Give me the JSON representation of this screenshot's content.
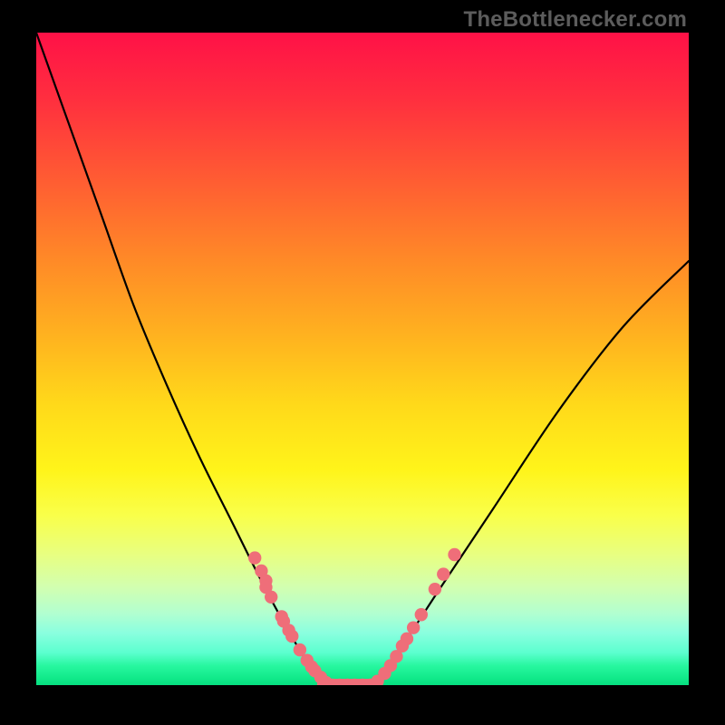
{
  "watermark": "TheBottlenecker.com",
  "chart_data": {
    "type": "line",
    "title": "",
    "xlabel": "",
    "ylabel": "",
    "xlim": [
      0,
      1
    ],
    "ylim": [
      0,
      1
    ],
    "grid": false,
    "series": [
      {
        "name": "curve",
        "color": "#000000",
        "x": [
          0.0,
          0.05,
          0.1,
          0.15,
          0.2,
          0.25,
          0.3,
          0.35,
          0.4,
          0.44,
          0.48,
          0.51,
          0.56,
          0.62,
          0.7,
          0.8,
          0.9,
          1.0
        ],
        "y": [
          1.0,
          0.86,
          0.72,
          0.58,
          0.46,
          0.35,
          0.25,
          0.15,
          0.06,
          0.0,
          0.0,
          0.0,
          0.06,
          0.15,
          0.27,
          0.42,
          0.55,
          0.65
        ]
      }
    ],
    "scatter_points": {
      "color": "#ef6e79",
      "radius_relative": 0.01,
      "points": [
        [
          0.335,
          0.195
        ],
        [
          0.345,
          0.175
        ],
        [
          0.352,
          0.16
        ],
        [
          0.352,
          0.15
        ],
        [
          0.36,
          0.135
        ],
        [
          0.376,
          0.105
        ],
        [
          0.379,
          0.098
        ],
        [
          0.387,
          0.084
        ],
        [
          0.392,
          0.075
        ],
        [
          0.404,
          0.054
        ],
        [
          0.415,
          0.038
        ],
        [
          0.422,
          0.028
        ],
        [
          0.427,
          0.022
        ],
        [
          0.436,
          0.012
        ],
        [
          0.444,
          0.004
        ],
        [
          0.454,
          0.0
        ],
        [
          0.465,
          0.0
        ],
        [
          0.477,
          0.0
        ],
        [
          0.488,
          0.0
        ],
        [
          0.5,
          0.0
        ],
        [
          0.512,
          0.0
        ],
        [
          0.523,
          0.006
        ],
        [
          0.534,
          0.018
        ],
        [
          0.543,
          0.03
        ],
        [
          0.552,
          0.044
        ],
        [
          0.561,
          0.06
        ],
        [
          0.568,
          0.071
        ],
        [
          0.578,
          0.088
        ],
        [
          0.59,
          0.108
        ],
        [
          0.611,
          0.147
        ],
        [
          0.624,
          0.17
        ],
        [
          0.641,
          0.2
        ]
      ]
    },
    "baseline_segments": [
      {
        "y": 0.0,
        "x0": 0.44,
        "x1": 0.515
      }
    ]
  }
}
